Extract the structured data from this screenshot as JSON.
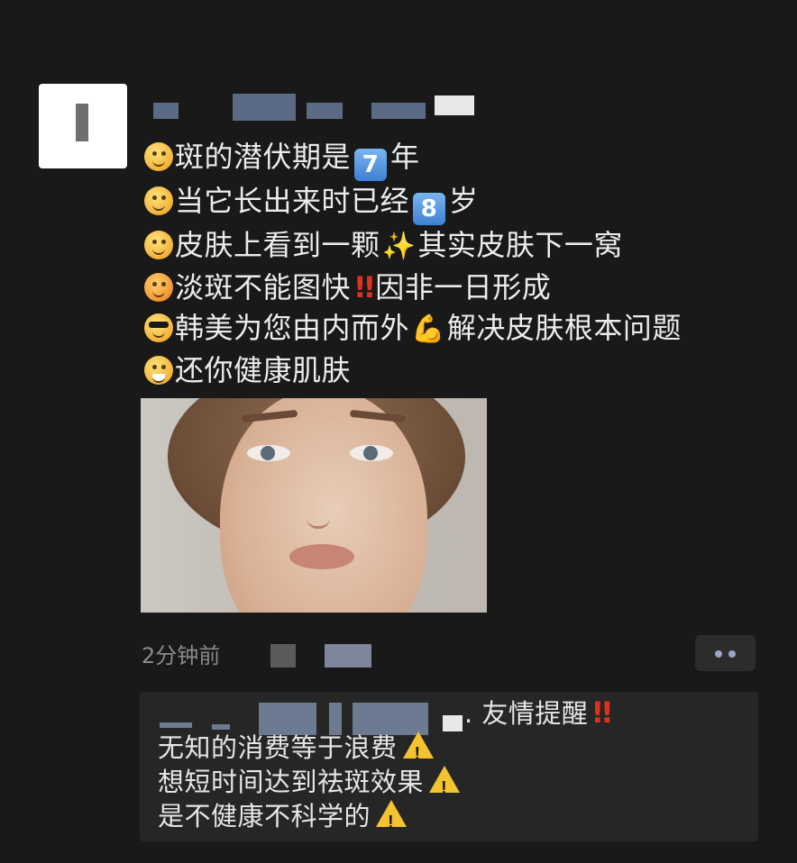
{
  "post": {
    "lines": [
      {
        "emoji": "dizzy-face",
        "text_before": "斑的潜伏期是",
        "keycap": "7",
        "text_after": "年"
      },
      {
        "emoji": "swirl-eyes-face",
        "text_before": "当它长出来时已经",
        "keycap": "8",
        "text_after": "岁"
      },
      {
        "emoji": "sweat-face",
        "text_before": "皮肤上看到一颗",
        "icon": "sparkles",
        "text_after": "其实皮肤下一窝"
      },
      {
        "emoji": "angry-face",
        "text_before": "淡斑不能图快",
        "icon": "double-exclamation",
        "text_after": "因非一日形成"
      },
      {
        "emoji": "sunglasses-face",
        "text_before": "韩美为您由内而外",
        "icon": "flexed-biceps",
        "text_after": "解决皮肤根本问题"
      },
      {
        "emoji": "grinning-face",
        "text_before": "还你健康肌肤"
      }
    ],
    "time": "2分钟前",
    "photo_alt": "woman-with-freckles"
  },
  "comment": {
    "head_text": ". 友情提醒",
    "head_icon": "double-exclamation",
    "lines": [
      "无知的消费等于浪费",
      "想短时间达到祛斑效果",
      "是不健康不科学的"
    ],
    "line_icon": "warning"
  },
  "colors": {
    "background": "#191919",
    "comment_bg": "#262626",
    "text": "#eaeaea",
    "muted": "#8a8a8a",
    "warning": "#f4c430",
    "alert_red": "#e0311f"
  }
}
